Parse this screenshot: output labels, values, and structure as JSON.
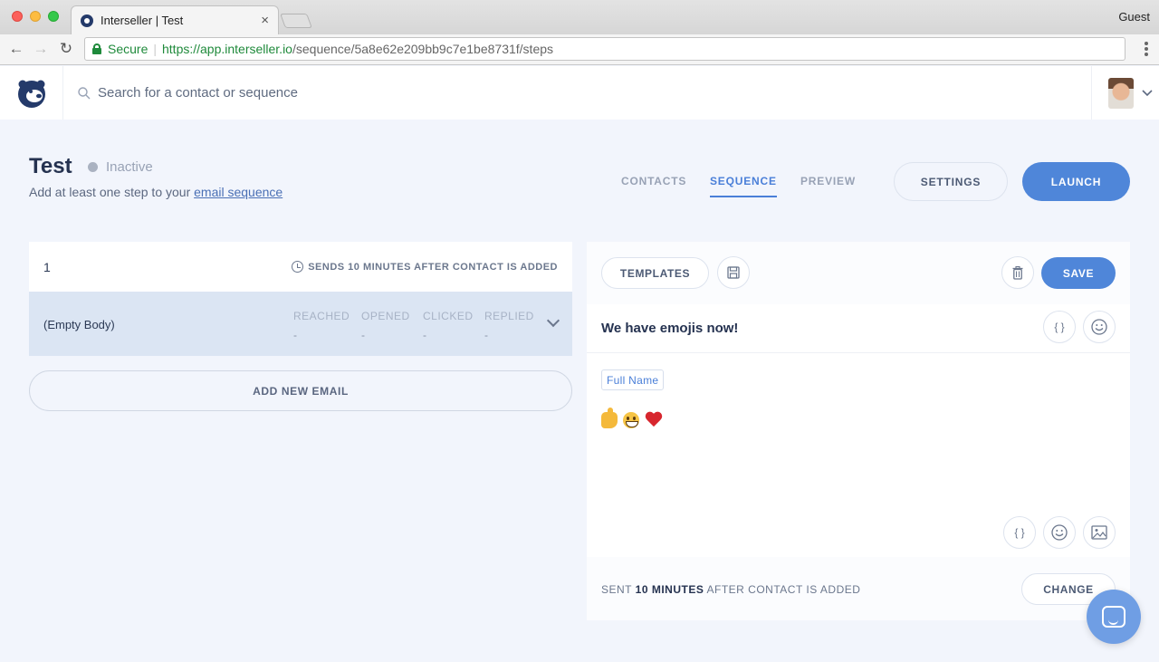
{
  "browser": {
    "tab_title": "Interseller | Test",
    "tab_close": "×",
    "profile": "Guest",
    "secure_label": "Secure",
    "url_host": "https://app.interseller.io",
    "url_path": "/sequence/5a8e62e209bb9c7e1be8731f/steps",
    "back_glyph": "←",
    "forward_glyph": "→",
    "reload_glyph": "↻"
  },
  "header": {
    "search_placeholder": "Search for a contact or sequence",
    "search_value": ""
  },
  "sequence": {
    "title": "Test",
    "status": "Inactive",
    "subtitle_prefix": "Add at least one step to your",
    "subtitle_link": "email sequence"
  },
  "nav": {
    "tabs": [
      {
        "label": "CONTACTS",
        "active": false
      },
      {
        "label": "SEQUENCE",
        "active": true
      },
      {
        "label": "PREVIEW",
        "active": false
      }
    ],
    "settings_label": "SETTINGS",
    "launch_label": "LAUNCH"
  },
  "step": {
    "number": "1",
    "timing": "SENDS 10 MINUTES AFTER CONTACT IS ADDED",
    "body": "(Empty Body)",
    "stats": [
      {
        "label": "REACHED",
        "value": "-"
      },
      {
        "label": "OPENED",
        "value": "-"
      },
      {
        "label": "CLICKED",
        "value": "-"
      },
      {
        "label": "REPLIED",
        "value": "-"
      }
    ],
    "add_email_label": "ADD NEW EMAIL"
  },
  "editor": {
    "templates_label": "TEMPLATES",
    "save_label": "SAVE",
    "subject": "We have emojis now!",
    "variable_glyph": "{ }",
    "chip_label": "Full Name",
    "footer_prefix": "SENT",
    "footer_bold": "10 MINUTES",
    "footer_suffix": "AFTER CONTACT IS ADDED",
    "change_label": "CHANGE"
  },
  "colors": {
    "accent": "#4f86d9",
    "page_bg": "#f2f5fc",
    "row_highlight": "#dbe5f3",
    "secure_green": "#1f8a3b"
  }
}
